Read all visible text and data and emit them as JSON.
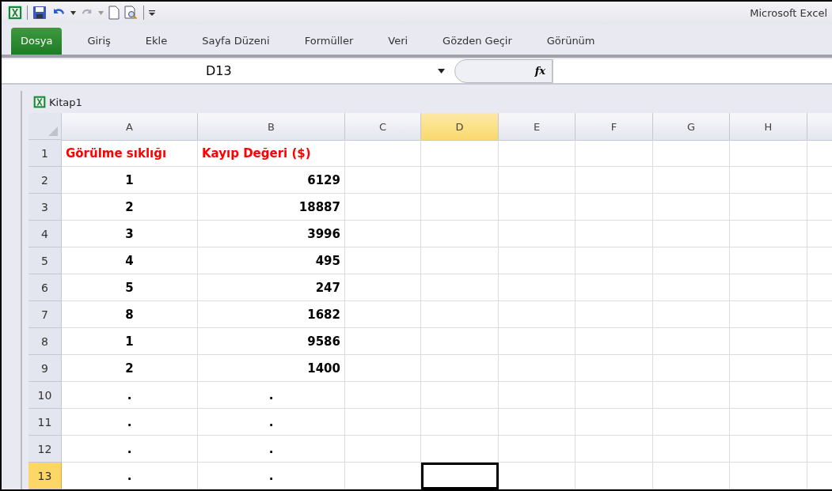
{
  "window": {
    "title": "Microsoft Excel"
  },
  "ribbon_tabs": [
    {
      "label": "Dosya",
      "selected": true
    },
    {
      "label": "Giriş",
      "selected": false
    },
    {
      "label": "Ekle",
      "selected": false
    },
    {
      "label": "Sayfa Düzeni",
      "selected": false
    },
    {
      "label": "Formüller",
      "selected": false
    },
    {
      "label": "Veri",
      "selected": false
    },
    {
      "label": "Gözden Geçir",
      "selected": false
    },
    {
      "label": "Görünüm",
      "selected": false
    }
  ],
  "formula_bar": {
    "name_box": "D13",
    "function_label": "fx"
  },
  "workbook": {
    "title": "Kitap1"
  },
  "table": {
    "columns": [
      {
        "label": "A",
        "selected": false
      },
      {
        "label": "B",
        "selected": false
      },
      {
        "label": "C",
        "selected": false
      },
      {
        "label": "D",
        "selected": true
      },
      {
        "label": "E",
        "selected": false
      },
      {
        "label": "F",
        "selected": false
      },
      {
        "label": "G",
        "selected": false
      },
      {
        "label": "H",
        "selected": false
      }
    ],
    "rows": [
      {
        "label": "1",
        "selected": false,
        "kind": "heading",
        "cells": [
          "Görülme sıklığı",
          "Kayıp Değeri ($)"
        ]
      },
      {
        "label": "2",
        "selected": false,
        "kind": "number",
        "cells": [
          "1",
          "6129"
        ]
      },
      {
        "label": "3",
        "selected": false,
        "kind": "number",
        "cells": [
          "2",
          "18887"
        ]
      },
      {
        "label": "4",
        "selected": false,
        "kind": "number",
        "cells": [
          "3",
          "3996"
        ]
      },
      {
        "label": "5",
        "selected": false,
        "kind": "number",
        "cells": [
          "4",
          "495"
        ]
      },
      {
        "label": "6",
        "selected": false,
        "kind": "number",
        "cells": [
          "5",
          "247"
        ]
      },
      {
        "label": "7",
        "selected": false,
        "kind": "number",
        "cells": [
          "8",
          "1682"
        ]
      },
      {
        "label": "8",
        "selected": false,
        "kind": "number",
        "cells": [
          "1",
          "9586"
        ]
      },
      {
        "label": "9",
        "selected": false,
        "kind": "number",
        "cells": [
          "2",
          "1400"
        ]
      },
      {
        "label": "10",
        "selected": false,
        "kind": "ellipsis",
        "cells": [
          ".",
          "."
        ]
      },
      {
        "label": "11",
        "selected": false,
        "kind": "ellipsis",
        "cells": [
          ".",
          "."
        ]
      },
      {
        "label": "12",
        "selected": false,
        "kind": "ellipsis",
        "cells": [
          ".",
          "."
        ]
      },
      {
        "label": "13",
        "selected": true,
        "kind": "ellipsis",
        "cells": [
          ".",
          "."
        ]
      }
    ]
  }
}
